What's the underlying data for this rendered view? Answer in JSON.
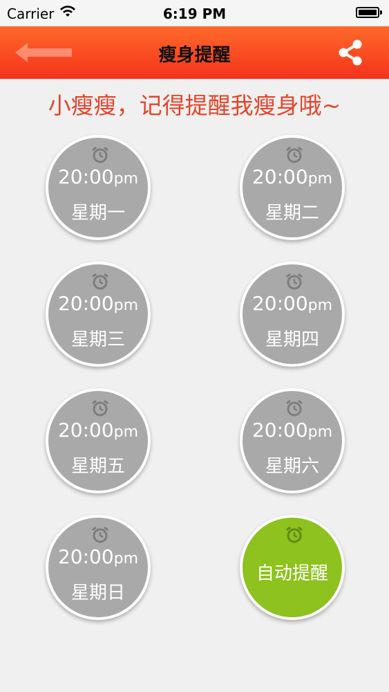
{
  "status_bar": {
    "carrier": "Carrier",
    "time": "6:19 PM"
  },
  "nav": {
    "title": "瘦身提醒"
  },
  "tagline": "小瘦瘦，记得提醒我瘦身哦~",
  "reminders": [
    {
      "time": "20:00",
      "ampm": "pm",
      "day": "星期一"
    },
    {
      "time": "20:00",
      "ampm": "pm",
      "day": "星期二"
    },
    {
      "time": "20:00",
      "ampm": "pm",
      "day": "星期三"
    },
    {
      "time": "20:00",
      "ampm": "pm",
      "day": "星期四"
    },
    {
      "time": "20:00",
      "ampm": "pm",
      "day": "星期五"
    },
    {
      "time": "20:00",
      "ampm": "pm",
      "day": "星期六"
    },
    {
      "time": "20:00",
      "ampm": "pm",
      "day": "星期日"
    }
  ],
  "auto": {
    "label": "自动提醒"
  },
  "colors": {
    "nav_top": "#ff6a2a",
    "nav_bottom": "#f5321c",
    "tagline": "#e4442a",
    "circle_gray": "#a9a9a9",
    "auto_green": "#8dc21f"
  },
  "icons": {
    "alarm": "alarm-clock-icon",
    "share": "share-icon",
    "back": "back-arrow-icon",
    "wifi": "wifi-icon",
    "battery": "battery-icon"
  }
}
